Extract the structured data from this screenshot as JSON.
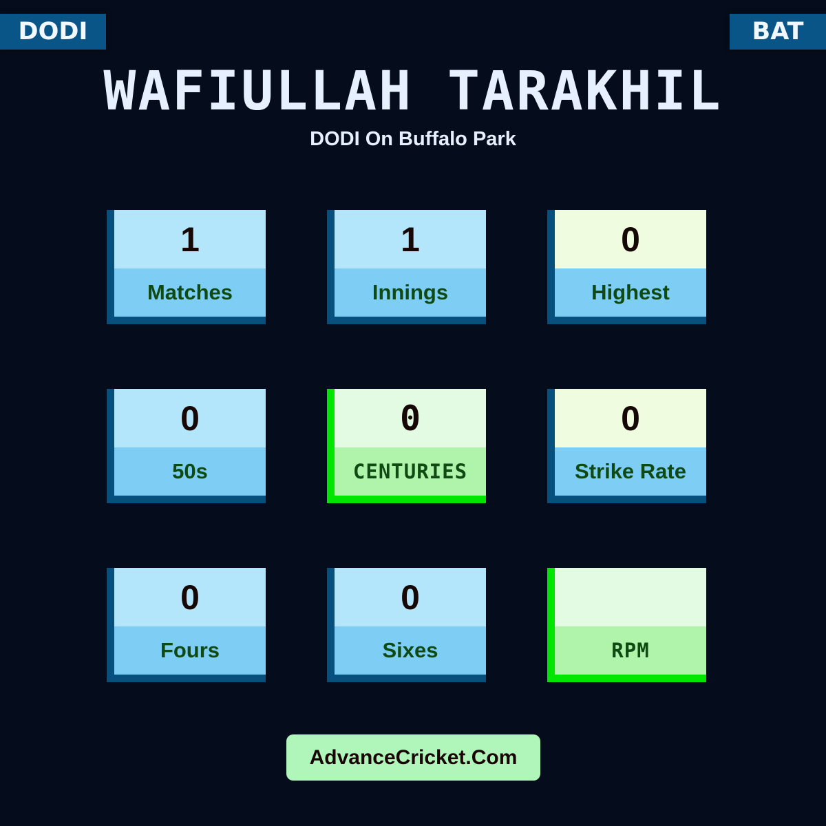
{
  "header": {
    "format_tag": "DODI",
    "role_tag": "BAT",
    "player_name": "WAFIULLAH TARAKHIL",
    "subtitle": "DODI On Buffalo Park"
  },
  "stats": [
    {
      "value": "1",
      "label": "Matches",
      "style": "blue"
    },
    {
      "value": "1",
      "label": "Innings",
      "style": "blue"
    },
    {
      "value": "0",
      "label": "Highest",
      "style": "cream"
    },
    {
      "value": "0",
      "label": "50s",
      "style": "blue"
    },
    {
      "value": "0",
      "label": "CENTURIES",
      "style": "green"
    },
    {
      "value": "0",
      "label": "Strike Rate",
      "style": "cream"
    },
    {
      "value": "0",
      "label": "Fours",
      "style": "blue"
    },
    {
      "value": "0",
      "label": "Sixes",
      "style": "blue"
    },
    {
      "value": "",
      "label": "RPM",
      "style": "green"
    }
  ],
  "footer": {
    "site_label": "AdvanceCricket.Com"
  },
  "colors": {
    "background": "#050d1c",
    "tag_bg": "#0a5587",
    "highlight_green": "#00e600"
  }
}
